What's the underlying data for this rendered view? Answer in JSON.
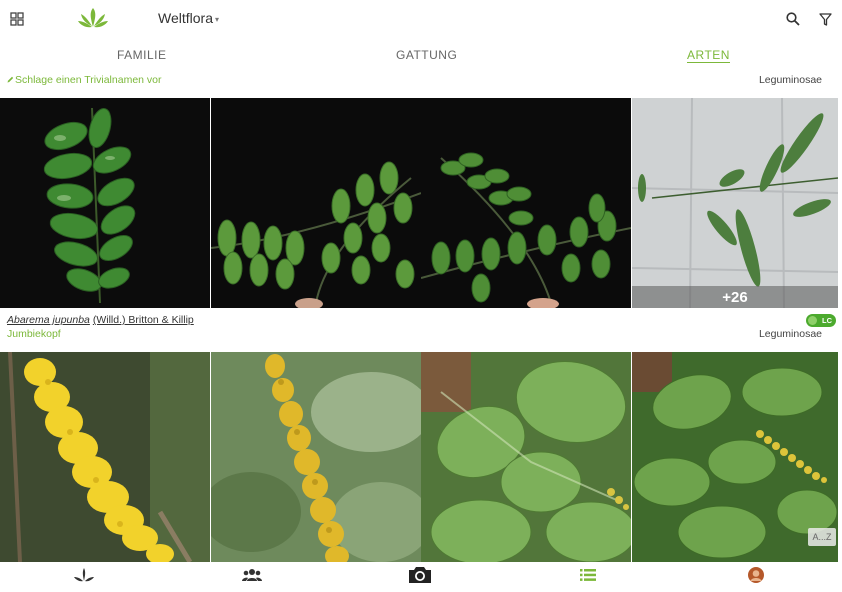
{
  "app": {
    "title": "Weltflora",
    "accent": "#7cb83a"
  },
  "topbar": {
    "menu_icon": "grid-icon",
    "logo_icon": "leaf-logo-icon",
    "search_icon": "search-icon",
    "filter_icon": "filter-icon"
  },
  "tabs": [
    {
      "label": "FAMILIE",
      "active": false
    },
    {
      "label": "GATTUNG",
      "active": false
    },
    {
      "label": "ARTEN",
      "active": true
    }
  ],
  "groups": [
    {
      "suggest_label": "Schlage einen Trivialnamen vor",
      "family": "Leguminosae",
      "more_count": "+26"
    },
    {
      "scientific_name": "Abarema jupunba",
      "authority": "(Willd.) Britton & Killip",
      "common_name": "Jumbiekopf",
      "status_badge": "LC",
      "family": "Leguminosae",
      "az_label": "A...Z"
    }
  ],
  "bottom_nav": [
    {
      "icon": "plant-icon"
    },
    {
      "icon": "community-icon"
    },
    {
      "icon": "camera-icon"
    },
    {
      "icon": "list-icon",
      "active": true
    },
    {
      "icon": "profile-avatar-icon"
    }
  ]
}
